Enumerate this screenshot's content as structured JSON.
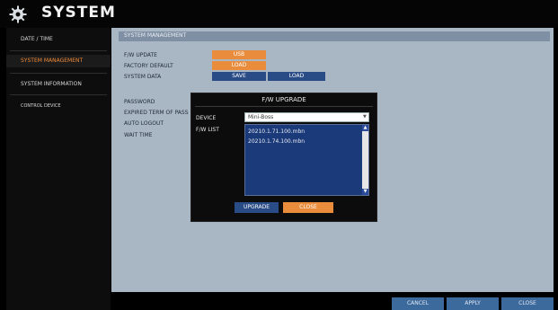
{
  "header": {
    "title": "SYSTEM",
    "icon": "gear-icon"
  },
  "sidebar": {
    "items": [
      {
        "label": "DATE / TIME"
      },
      {
        "label": "SYSTEM MANAGEMENT",
        "active": true
      },
      {
        "label": "SYSTEM INFORMATION"
      },
      {
        "label": "CONTROL DEVICE"
      }
    ]
  },
  "main": {
    "section_title": "SYSTEM MANAGEMENT",
    "rows": {
      "fw_update": "F/W UPDATE",
      "factory_default": "FACTORY DEFAULT",
      "system_data": "SYSTEM DATA",
      "password": "PASSWORD",
      "expired_term": "EXPIRED TERM OF PASS",
      "auto_logout": "AUTO LOGOUT",
      "wait_time": "WAIT TIME"
    },
    "buttons": {
      "usb": "USB",
      "load_default": "LOAD",
      "save": "SAVE",
      "load_data": "LOAD"
    }
  },
  "dialog": {
    "title": "F/W UPGRADE",
    "device_label": "DEVICE",
    "device_value": "Mini-Boss",
    "fw_list_label": "F/W LIST",
    "fw_items": [
      "20210.1.71.100.mbn",
      "20210.1.74.100.mbn"
    ],
    "upgrade_label": "UPGRADE",
    "close_label": "CLOSE"
  },
  "footer": {
    "cancel_label": "CANCEL",
    "apply_label": "APPLY",
    "close_label": "CLOSE"
  },
  "colors": {
    "accent_orange": "#e98c3c",
    "button_blue": "#2a4c86",
    "panel_bg": "#a9b6c4",
    "header_bg": "#050505"
  }
}
